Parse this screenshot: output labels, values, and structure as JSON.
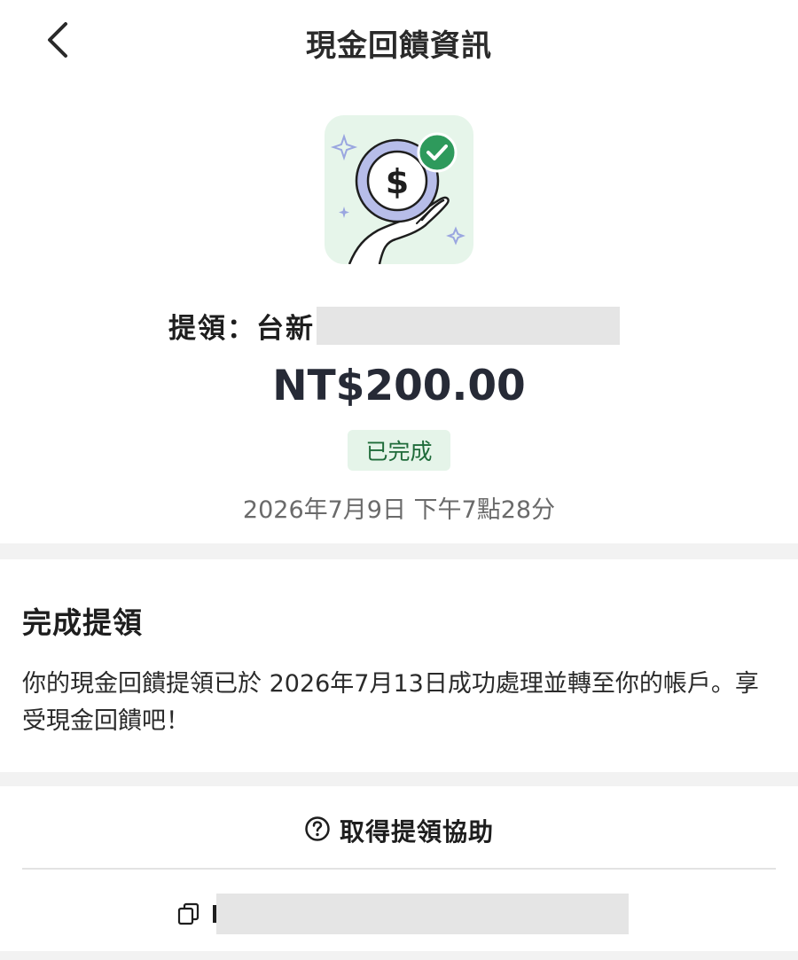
{
  "header": {
    "title": "現金回饋資訊",
    "back_icon": "chevron-left-icon"
  },
  "illustration": {
    "icon": "cashback-coin-hand-icon",
    "check_icon": "check-circle-icon",
    "background_color": "#e6f5ea",
    "check_color": "#2e9a5c"
  },
  "withdrawal": {
    "label": "提領：台新",
    "amount": "NT$200.00",
    "status": "已完成",
    "status_color": "#1f6b3a",
    "timestamp": "2026年7月9日 下午7點28分"
  },
  "completion": {
    "heading": "完成提領",
    "body": "你的現金回饋提領已於 2026年7月13日成功處理並轉至你的帳戶。享受現金回饋吧！"
  },
  "help": {
    "label": "取得提領協助",
    "icon": "question-circle-icon"
  },
  "reference": {
    "copy_icon": "copy-icon"
  }
}
